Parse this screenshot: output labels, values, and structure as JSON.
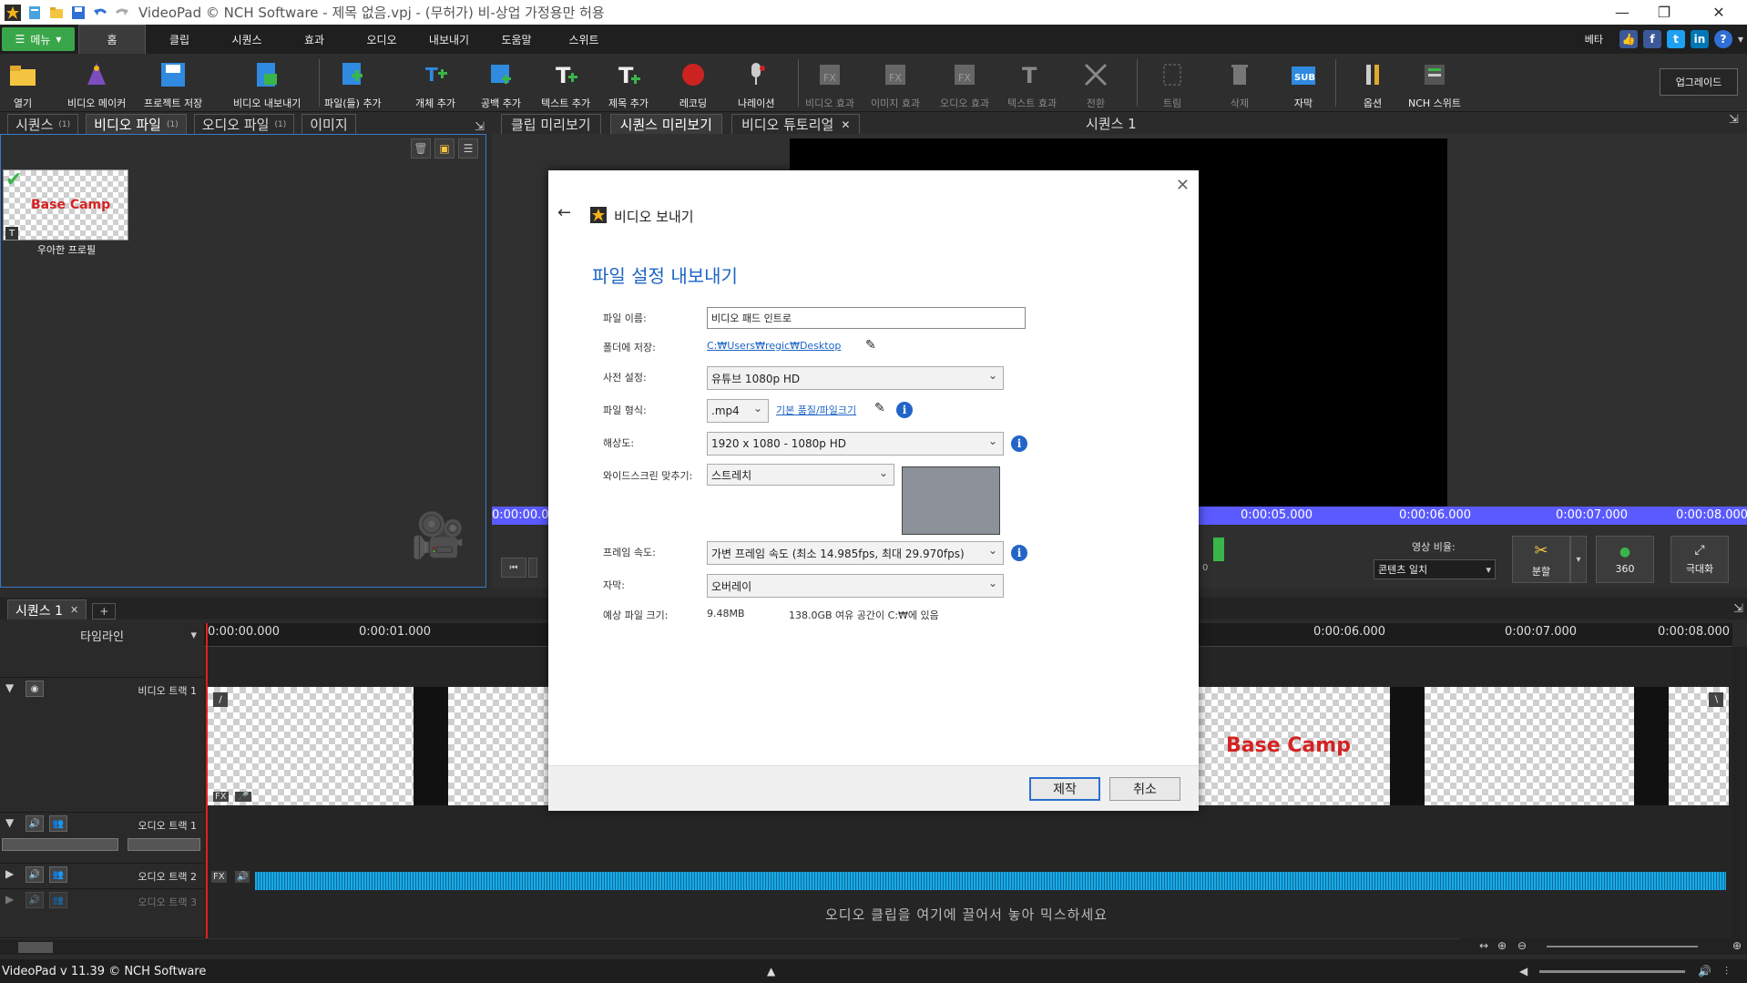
{
  "titlebar": {
    "title": "VideoPad © NCH Software - 제목 없음.vpj - (무허가) 비-상업 가정용만 허용"
  },
  "menu": {
    "menu_label": "메뉴",
    "tabs": [
      "홈",
      "클립",
      "시퀀스",
      "효과",
      "오디오",
      "내보내기",
      "도움말",
      "스위트"
    ],
    "active_tab": "홈",
    "beta_label": "베타"
  },
  "toolbar": {
    "items": [
      {
        "label": "열기"
      },
      {
        "label": "비디오 메이커"
      },
      {
        "label": "프로젝트 저장"
      },
      {
        "label": "비디오 내보내기"
      },
      {
        "label": "파일(들) 추가"
      },
      {
        "label": "개체 추가"
      },
      {
        "label": "공백 추가"
      },
      {
        "label": "텍스트 추가"
      },
      {
        "label": "제목 추가"
      },
      {
        "label": "레코딩"
      },
      {
        "label": "나레이션"
      },
      {
        "label": "비디오 효과"
      },
      {
        "label": "이미지 효과"
      },
      {
        "label": "오디오 효과"
      },
      {
        "label": "텍스트 효과"
      },
      {
        "label": "전환"
      },
      {
        "label": "트림"
      },
      {
        "label": "삭제"
      },
      {
        "label": "자막"
      },
      {
        "label": "옵션"
      },
      {
        "label": "NCH 스위트"
      }
    ],
    "upgrade_label": "업그레이드"
  },
  "left_tabs": [
    {
      "label": "시퀀스",
      "count": "(1)"
    },
    {
      "label": "비디오 파일",
      "count": "(1)"
    },
    {
      "label": "오디오 파일",
      "count": "(1)"
    },
    {
      "label": "이미지",
      "count": ""
    }
  ],
  "media": {
    "thumb_text": "Base Camp",
    "thumb_label": "우아한 프로필"
  },
  "preview_tabs": [
    {
      "label": "클립 미리보기"
    },
    {
      "label": "시퀀스 미리보기"
    },
    {
      "label": "비디오 튜토리얼"
    }
  ],
  "sequence_title": "시퀀스 1",
  "preview_ruler": [
    "0:00:00.0",
    "0:00:05.000",
    "0:00:06.000",
    "0:00:07.000",
    "0:00:08.000"
  ],
  "preview_controls": {
    "ratio_label": "영상 비율:",
    "ratio_value": "콘텐츠 일치",
    "split_label": "분할",
    "vr_label": "360",
    "max_label": "극대화",
    "counter": "0"
  },
  "timeline": {
    "seq_tab": "시퀀스 1",
    "header_label": "타임라인",
    "ruler": [
      "0:00:00.000",
      "0:00:01.000",
      "0:00:06.000",
      "0:00:07.000",
      "0:00:08.000"
    ],
    "tracks": [
      "비디오 트랙 1",
      "오디오 트랙 1",
      "오디오 트랙 2",
      "오디오 트랙 3"
    ],
    "clip_text": "Base Camp",
    "fx_label": "FX",
    "drop_message": "오디오 클립을 여기에 끌어서 놓아 믹스하세요"
  },
  "status": {
    "version": "VideoPad v 11.39 © NCH Software"
  },
  "dialog": {
    "title": "비디오 보내기",
    "heading": "파일 설정 내보내기",
    "filename_label": "파일 이름:",
    "filename_value": "비디오 패드 인트로",
    "folder_label": "폴더에 저장:",
    "folder_value": "C:₩Users₩regic₩Desktop",
    "preset_label": "사전 설정:",
    "preset_value": "유튜브 1080p HD",
    "format_label": "파일 형식:",
    "format_value": ".mp4",
    "quality_link": "기본 품질/파일크기",
    "resolution_label": "해상도:",
    "resolution_value": "1920 x 1080 - 1080p HD",
    "widescreen_label": "와이드스크린 맞추기:",
    "widescreen_value": "스트레치",
    "framerate_label": "프레임 속도:",
    "framerate_value": "가변 프레임 속도 (최소 14.985fps, 최대 29.970fps)",
    "subtitle_label": "자막:",
    "subtitle_value": "오버레이",
    "filesize_label": "예상 파일 크기:",
    "filesize_value": "9.48MB",
    "freespace_value": "138.0GB 여유 공간이 C:₩에 있음",
    "create_button": "제작",
    "cancel_button": "취소"
  }
}
